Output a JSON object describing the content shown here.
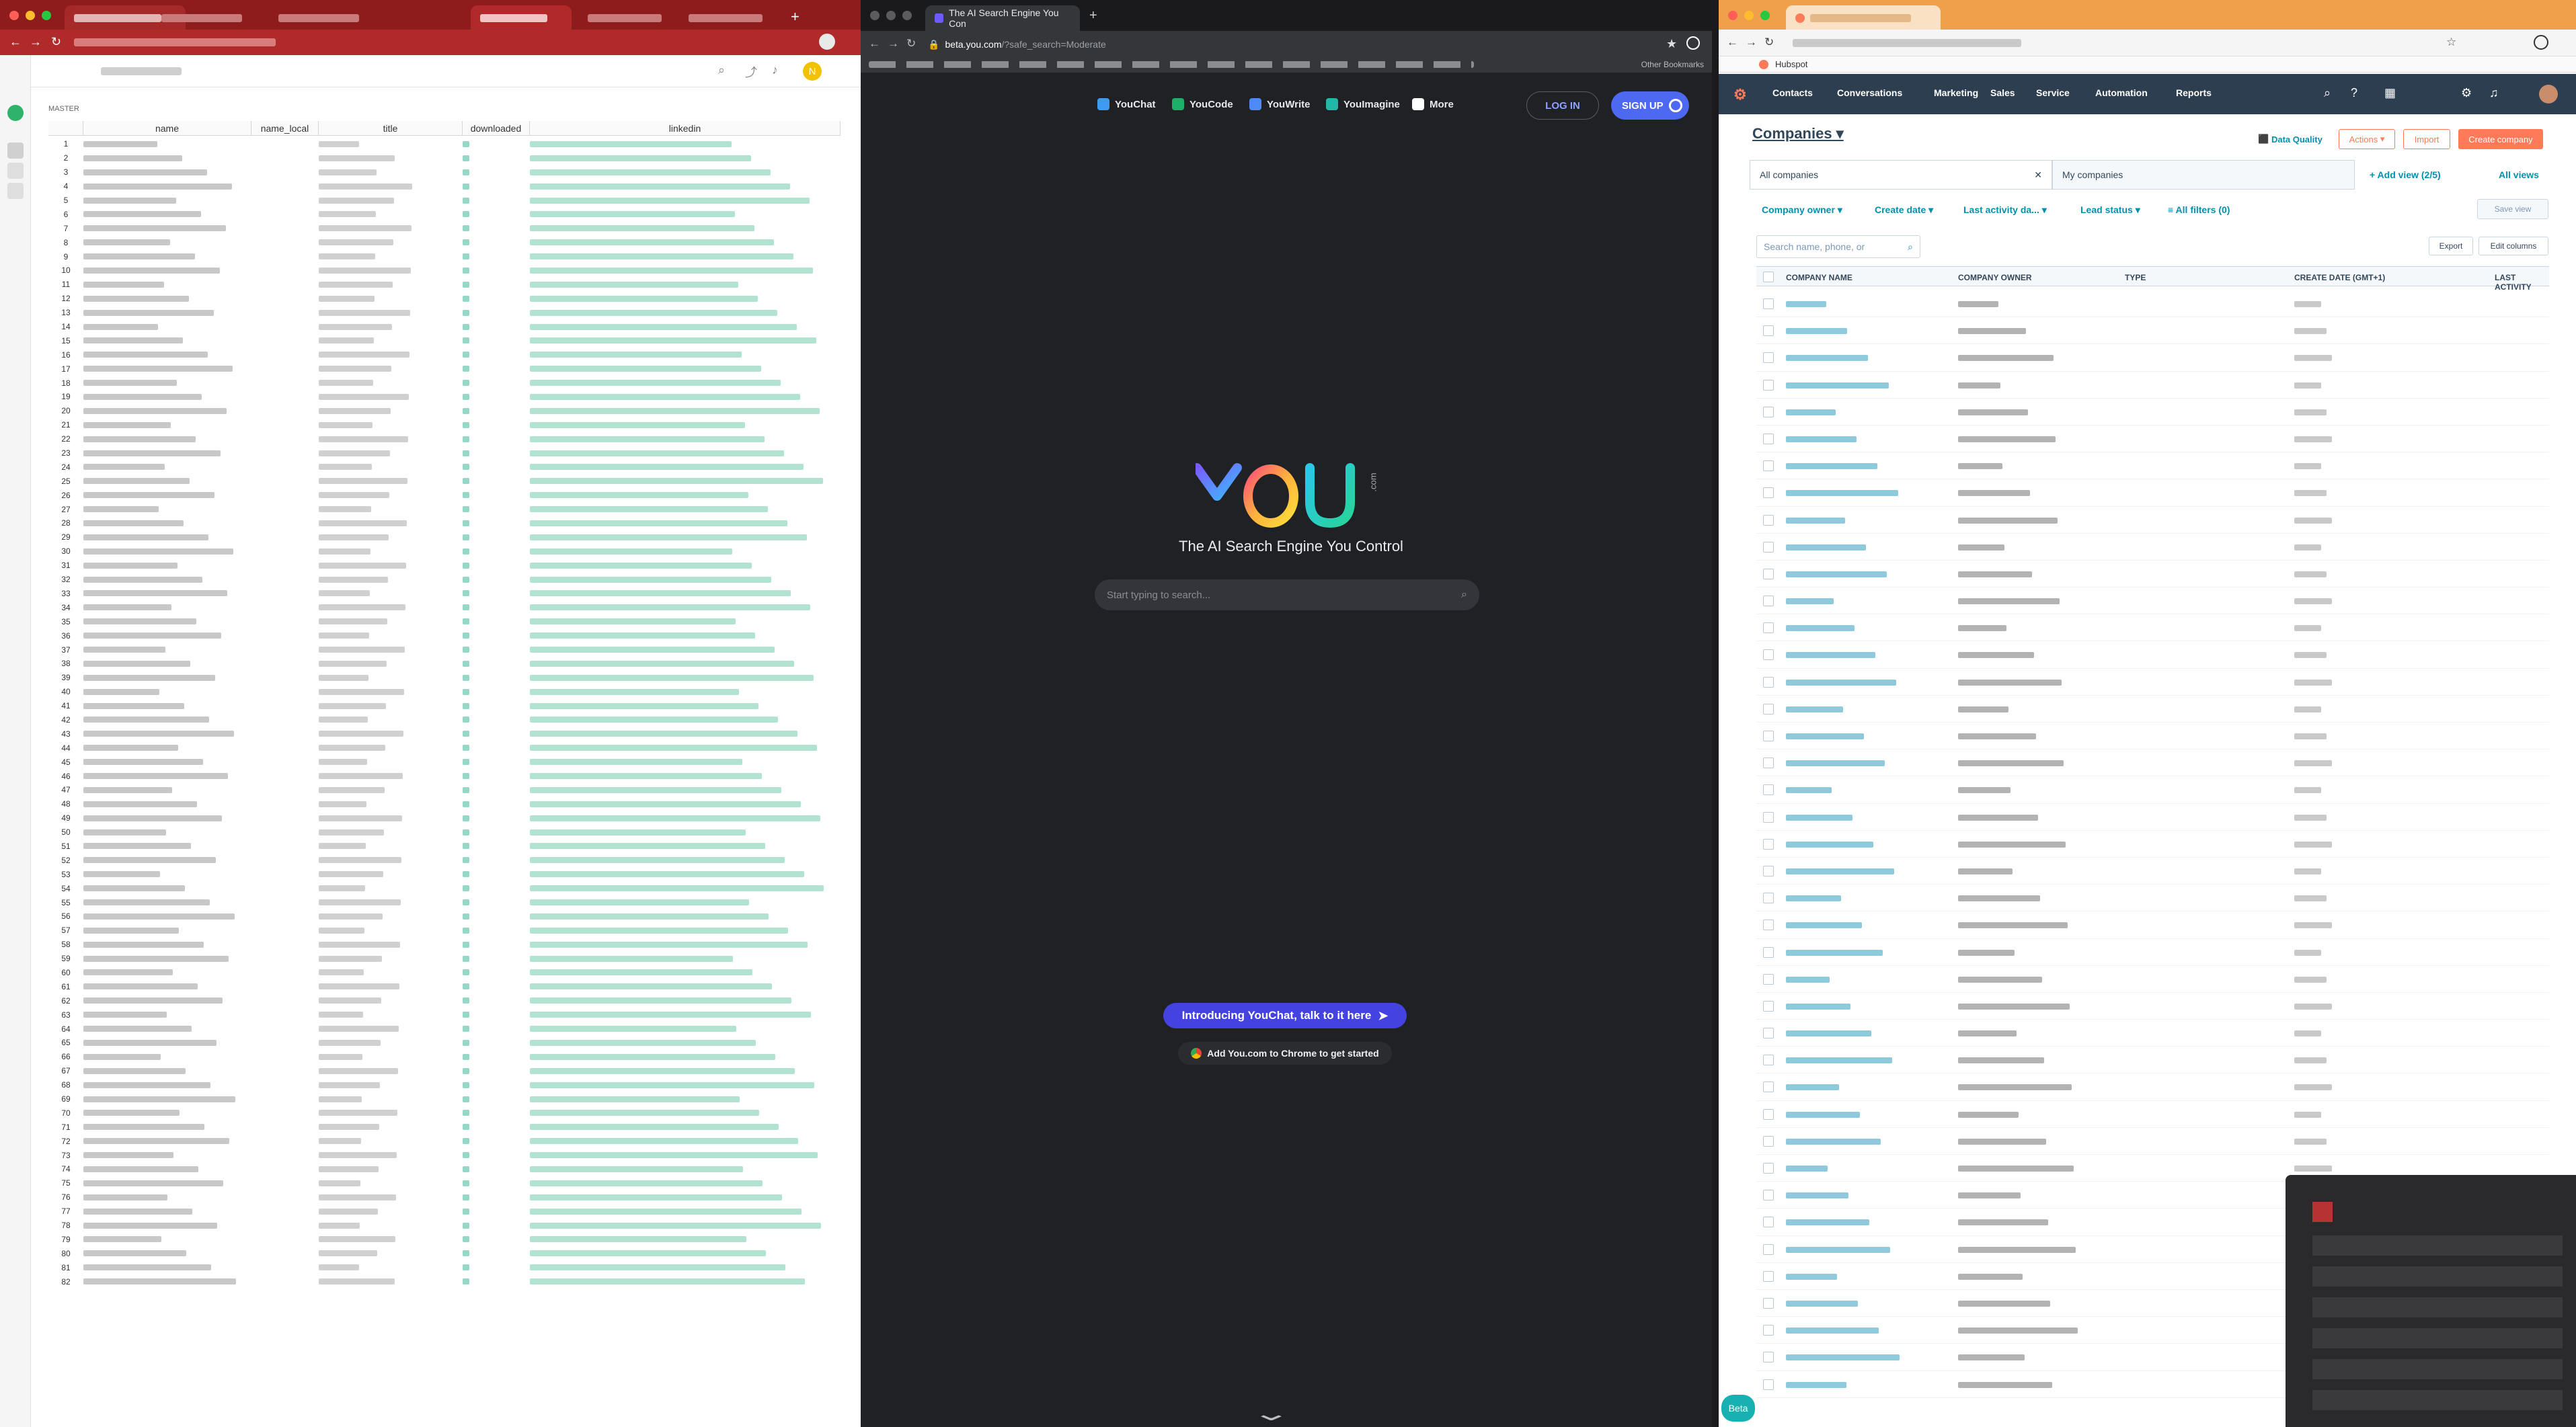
{
  "window_left": {
    "sheet_label": "MASTER",
    "columns": [
      "name",
      "name_local",
      "title",
      "downloaded",
      "linkedin"
    ],
    "row_numbers": [
      "1",
      "2",
      "3",
      "4",
      "5",
      "6",
      "7",
      "8",
      "9",
      "10",
      "11",
      "12",
      "13",
      "14",
      "15",
      "16",
      "17",
      "18",
      "19",
      "20",
      "21",
      "22",
      "23",
      "24",
      "25",
      "26",
      "27",
      "28",
      "29",
      "30",
      "31",
      "32",
      "33",
      "34",
      "35",
      "36",
      "37",
      "38",
      "39",
      "40",
      "41",
      "42",
      "43",
      "44",
      "45",
      "46",
      "47",
      "48",
      "49",
      "50",
      "51",
      "52",
      "53",
      "54",
      "55",
      "56",
      "57",
      "58",
      "59",
      "60",
      "61",
      "62",
      "63",
      "64",
      "65",
      "66",
      "67",
      "68",
      "69",
      "70",
      "71",
      "72",
      "73",
      "74",
      "75",
      "76",
      "77",
      "78",
      "79",
      "80",
      "81",
      "82"
    ],
    "avatar_letter": "N"
  },
  "window_middle": {
    "tab_title": "The AI Search Engine You Con",
    "url_host": "beta.you.com",
    "url_path": "/?safe_search=Moderate",
    "other_bookmarks": "Other Bookmarks",
    "nav": [
      "YouChat",
      "YouCode",
      "YouWrite",
      "YouImagine",
      "More"
    ],
    "login_label": "LOG IN",
    "signup_label": "SIGN UP",
    "logo_text": "YOU",
    "logo_suffix": ".com",
    "tagline": "The AI Search Engine You Control",
    "search_placeholder": "Start typing to search...",
    "promo_label": "Introducing YouChat, talk to it here",
    "chrome_label": "Add You.com to Chrome to get started"
  },
  "window_right": {
    "bookmark": "Hubspot",
    "nav": [
      "Contacts",
      "Conversations",
      "Marketing",
      "Sales",
      "Service",
      "Automation",
      "Reports"
    ],
    "page_title": "Companies",
    "data_quality": "Data Quality",
    "actions_label": "Actions",
    "import_label": "Import",
    "create_label": "Create company",
    "tabs": [
      "All companies",
      "My companies"
    ],
    "add_view": "Add view (2/5)",
    "all_views": "All views",
    "filters": [
      "Company owner",
      "Create date",
      "Last activity da...",
      "Lead status"
    ],
    "all_filters": "All filters (0)",
    "save_view": "Save view",
    "search_placeholder": "Search name, phone, or",
    "export_label": "Export",
    "edit_columns": "Edit columns",
    "table_headers": [
      "COMPANY NAME",
      "COMPANY OWNER",
      "TYPE",
      "CREATE DATE (GMT+1)",
      "LAST ACTIVITY"
    ],
    "beta_label": "Beta"
  }
}
